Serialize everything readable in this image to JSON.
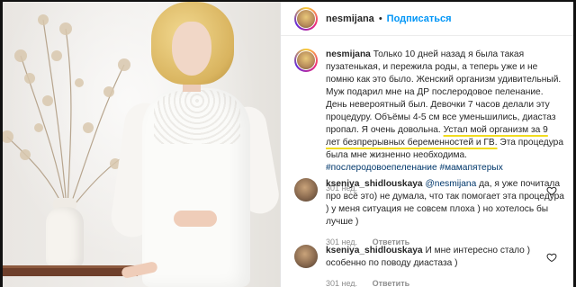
{
  "post": {
    "author": "nesmijana",
    "separator": "•",
    "follow_label": "Подписаться"
  },
  "caption": {
    "username": "nesmijana",
    "text_main": "Только 10 дней назад я была такая пузатенькая, и пережила роды, а теперь уже и не помню как это было. Женский организм удивительный. Муж подарил мне на ДР послеродовое пеленание. День невероятный был. Девочки 7 часов делали эту процедуру. Объёмы 4-5 см все уменьшились, диастаз пропал. Я очень довольна.",
    "text_highlight": "Устал мой организм за 9 лет безпрерывных беременностей и ГВ.",
    "text_end": "Эта процедура была мне жизненно необходима.",
    "hashtags": "#послеродовоепеленание #мамапятерых",
    "time": "301 нед."
  },
  "comments": [
    {
      "username": "kseniya_shidlouskaya",
      "mention": "@nesmijana",
      "text": "да, я уже почитала про всё это) не думала, что так помогает эта процедура ) у меня ситуация не совсем плоха ) но хотелось бы лучше )",
      "time": "301 нед.",
      "reply_label": "Ответить"
    },
    {
      "username": "kseniya_shidlouskaya",
      "mention": "",
      "text": "И мне интересно стало ) особенно по поводу диастаза )",
      "time": "301 нед.",
      "reply_label": "Ответить"
    }
  ],
  "colors": {
    "link_blue": "#0095f6",
    "hashtag": "#00376b",
    "highlight_underline": "#f2dc1f",
    "text": "#262626",
    "muted": "#8e8e8e"
  },
  "icons": [
    "heart-icon",
    "avatar-icon"
  ]
}
